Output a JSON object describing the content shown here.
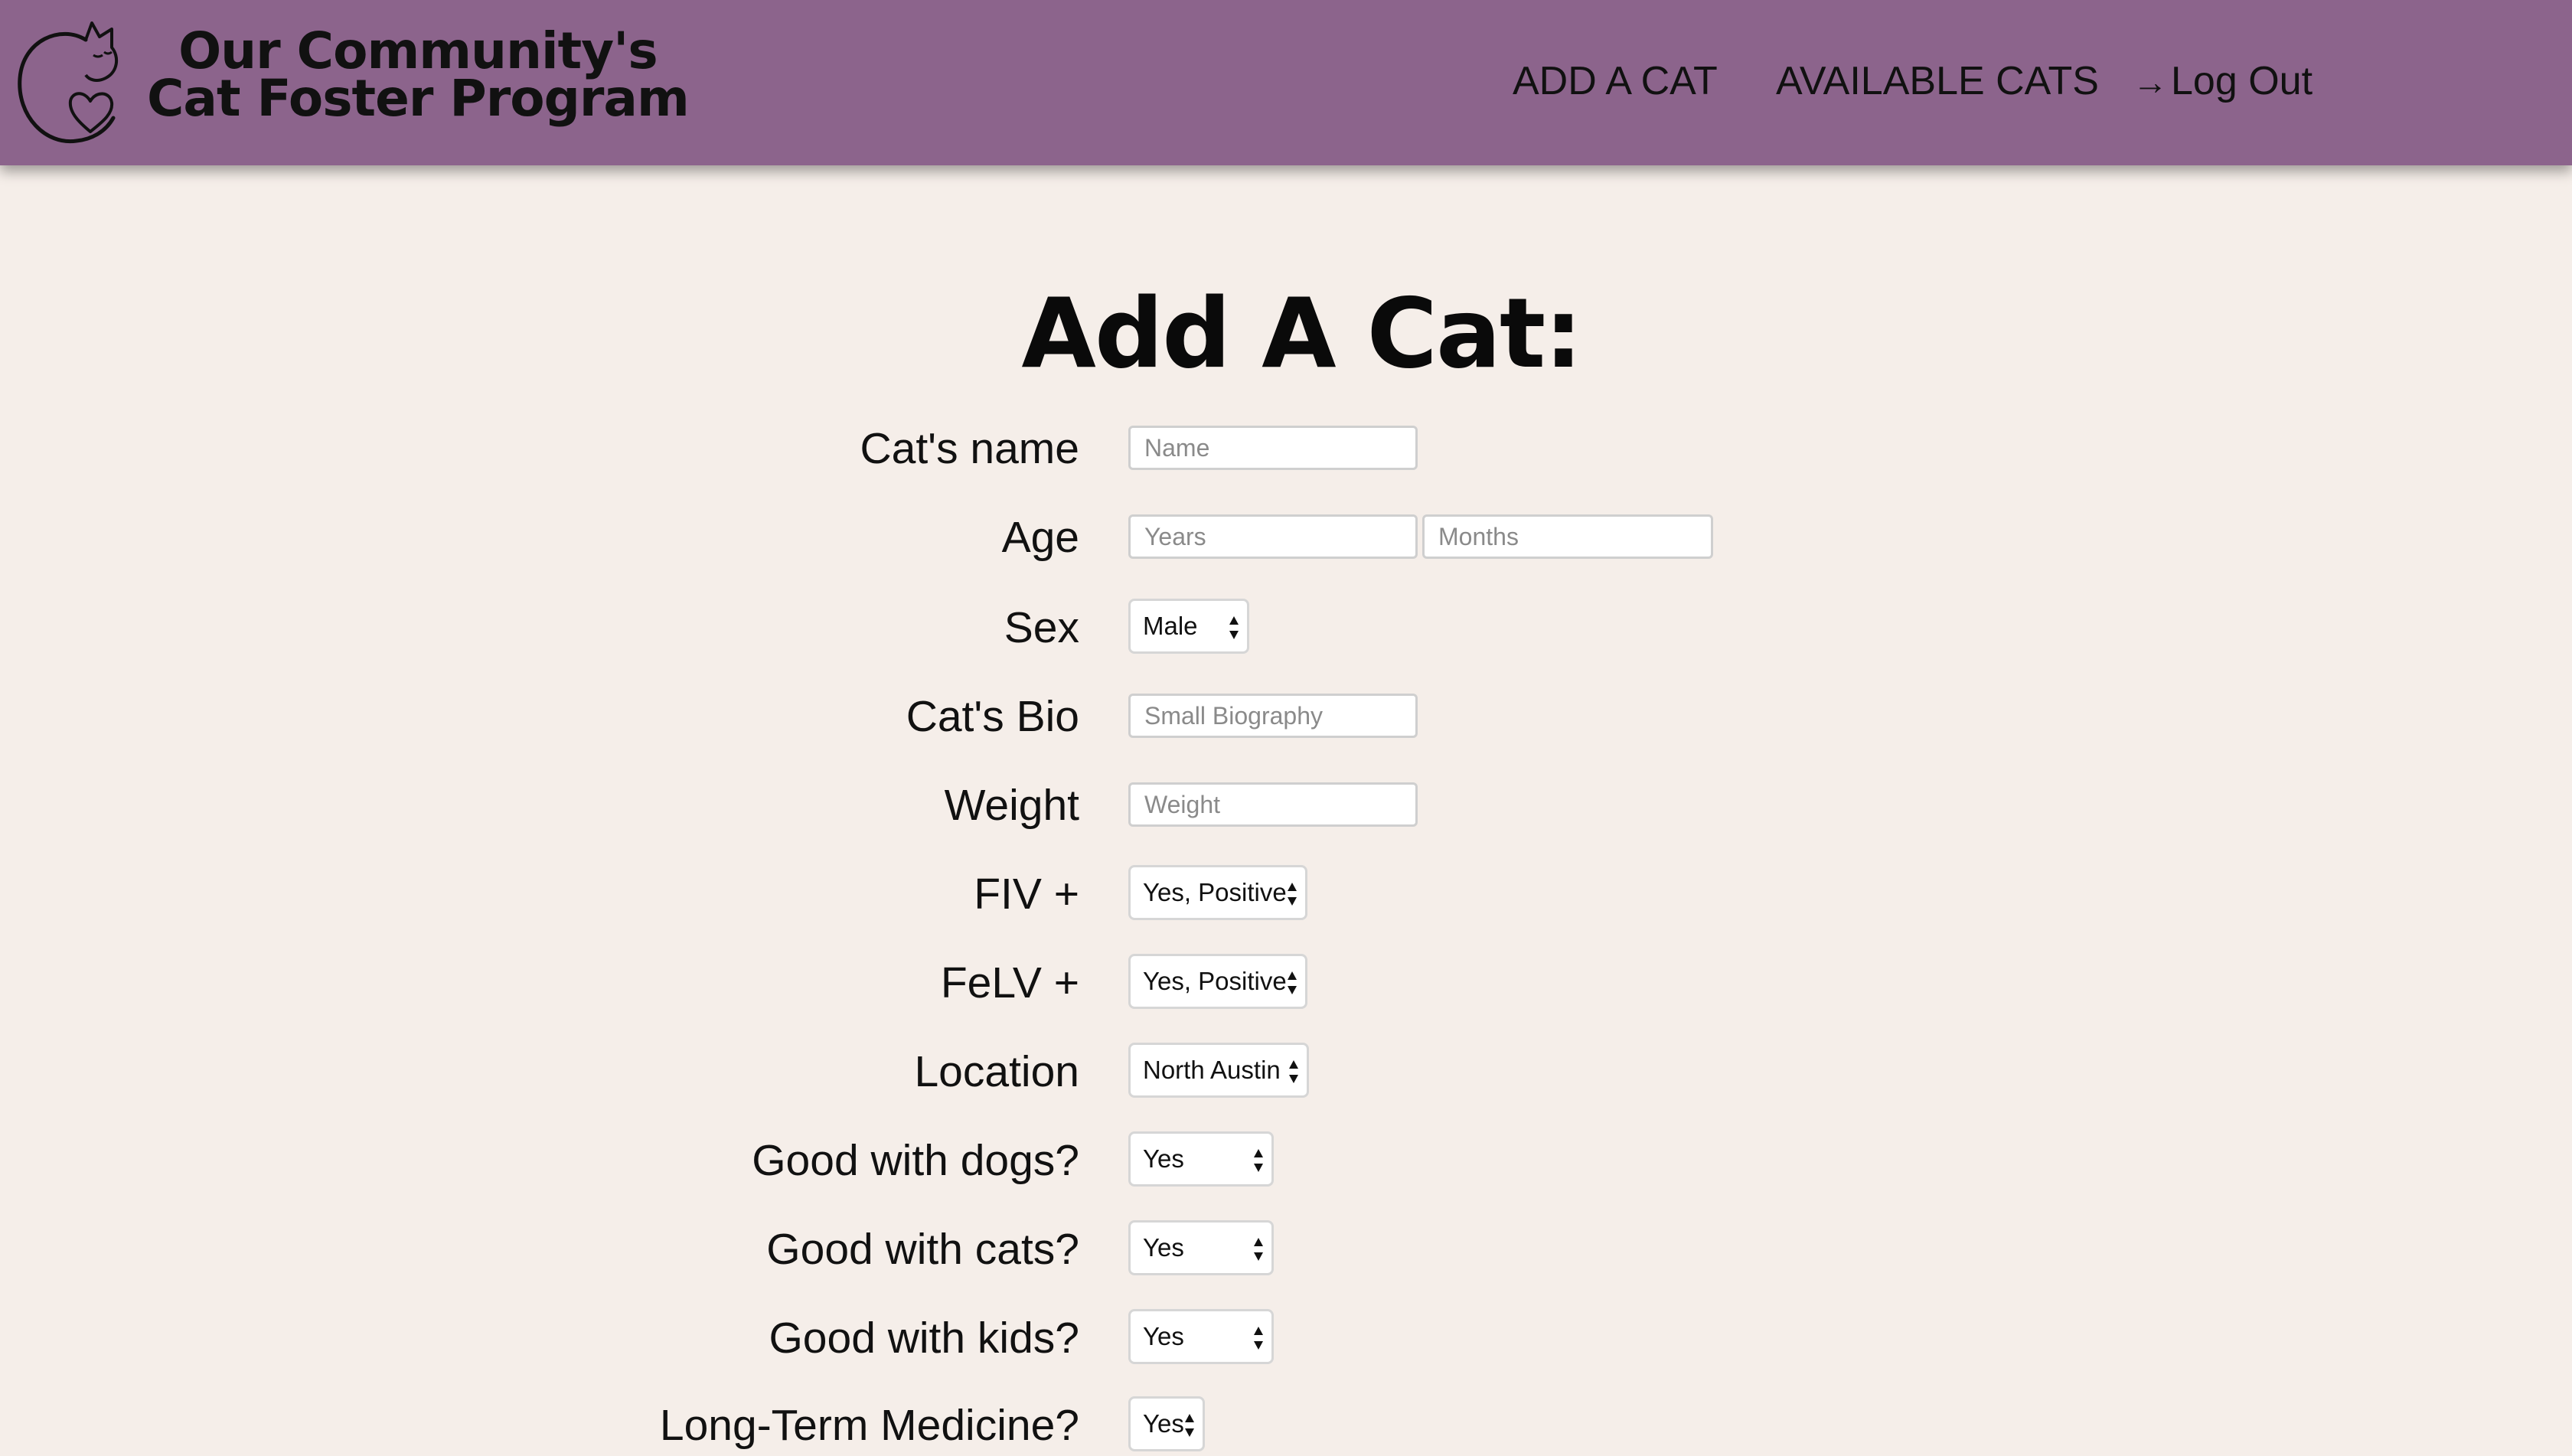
{
  "header": {
    "brand_line1": "Our Community's",
    "brand_line2": "Cat Foster Program",
    "nav": {
      "add_cat": "ADD A CAT",
      "available_cats": "AVAILABLE CATS",
      "logout_arrow": "→",
      "logout": "Log Out"
    }
  },
  "page": {
    "title": "Add A Cat:"
  },
  "form": {
    "name": {
      "label": "Cat's name",
      "placeholder": "Name"
    },
    "age": {
      "label": "Age",
      "years_placeholder": "Years",
      "months_placeholder": "Months"
    },
    "sex": {
      "label": "Sex",
      "value": "Male"
    },
    "bio": {
      "label": "Cat's Bio",
      "placeholder": "Small Biography"
    },
    "weight": {
      "label": "Weight",
      "placeholder": "Weight"
    },
    "fiv": {
      "label": "FIV +",
      "value": "Yes, Positive"
    },
    "felv": {
      "label": "FeLV +",
      "value": "Yes, Positive"
    },
    "location": {
      "label": "Location",
      "value": "North Austin"
    },
    "good_with_dogs": {
      "label": "Good with dogs?",
      "value": "Yes"
    },
    "good_with_cats": {
      "label": "Good with cats?",
      "value": "Yes"
    },
    "good_with_kids": {
      "label": "Good with kids?",
      "value": "Yes"
    },
    "long_term_medicine": {
      "label": "Long-Term Medicine?",
      "value": "Yes"
    }
  },
  "colors": {
    "header_bg": "#8c648c",
    "page_bg": "#f5eee9"
  }
}
